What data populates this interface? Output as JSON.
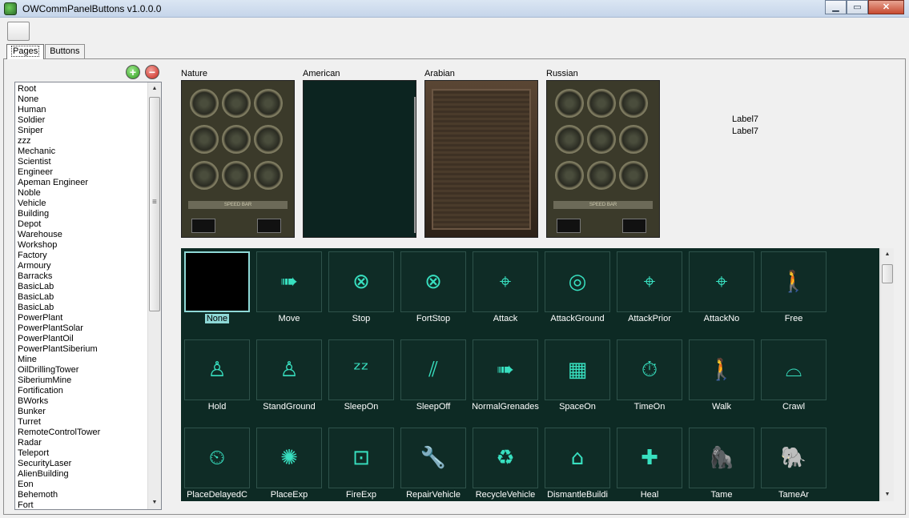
{
  "window": {
    "title": "OWCommPanelButtons v1.0.0.0",
    "minimize": "▁",
    "maximize": "▭",
    "close": "✕"
  },
  "tabs": [
    {
      "label": "Pages",
      "active": true
    },
    {
      "label": "Buttons",
      "active": false
    }
  ],
  "list_controls": {
    "add": "+",
    "remove": "−"
  },
  "pages": [
    "Root",
    "None",
    "Human",
    "Soldier",
    "Sniper",
    "zzz",
    "Mechanic",
    "Scientist",
    "Engineer",
    "Apeman Engineer",
    "Noble",
    "Vehicle",
    "Building",
    "Depot",
    "Warehouse",
    "Workshop",
    "Factory",
    "Armoury",
    "Barracks",
    "BasicLab",
    "BasicLab",
    "BasicLab",
    "PowerPlant",
    "PowerPlantSolar",
    "PowerPlantOil",
    "PowerPlantSiberium",
    "Mine",
    "OilDrillingTower",
    "SiberiumMine",
    "Fortification",
    "BWorks",
    "Bunker",
    "Turret",
    "RemoteControlTower",
    "Radar",
    "Teleport",
    "SecurityLaser",
    "AlienBuilding",
    "Eon",
    "Behemoth",
    "Fort"
  ],
  "factions": [
    {
      "name": "Nature",
      "style": "nature"
    },
    {
      "name": "American",
      "style": "american"
    },
    {
      "name": "Arabian",
      "style": "arabian"
    },
    {
      "name": "Russian",
      "style": "russian"
    }
  ],
  "speedbar_text": "SPEED BAR",
  "labels": [
    "Label7",
    "Label7"
  ],
  "buttons": [
    {
      "label": "None",
      "icon": "empty",
      "glyph": "",
      "selected": true
    },
    {
      "label": "Move",
      "icon": "move-arrows-icon",
      "glyph": "➠"
    },
    {
      "label": "Stop",
      "icon": "stop-icon",
      "glyph": "⊗"
    },
    {
      "label": "FortStop",
      "icon": "fort-stop-icon",
      "glyph": "⊗"
    },
    {
      "label": "Attack",
      "icon": "crosshair-icon",
      "glyph": "⌖"
    },
    {
      "label": "AttackGround",
      "icon": "attack-ground-icon",
      "glyph": "◎"
    },
    {
      "label": "AttackPrior",
      "icon": "attack-prior-icon",
      "glyph": "⌖"
    },
    {
      "label": "AttackNo",
      "icon": "attack-no-icon",
      "glyph": "⌖"
    },
    {
      "label": "Free",
      "icon": "free-person-icon",
      "glyph": "🚶"
    },
    {
      "label": "Hold",
      "icon": "hold-person-icon",
      "glyph": "♙"
    },
    {
      "label": "StandGround",
      "icon": "stand-ground-icon",
      "glyph": "♙"
    },
    {
      "label": "SleepOn",
      "icon": "sleep-on-icon",
      "glyph": "ᶻᶻ"
    },
    {
      "label": "SleepOff",
      "icon": "sleep-off-icon",
      "glyph": "⫽"
    },
    {
      "label": "NormalGrenades",
      "icon": "grenades-icon",
      "glyph": "➠"
    },
    {
      "label": "SpaceOn",
      "icon": "space-on-icon",
      "glyph": "▦"
    },
    {
      "label": "TimeOn",
      "icon": "time-on-icon",
      "glyph": "⏱"
    },
    {
      "label": "Walk",
      "icon": "walk-icon",
      "glyph": "🚶"
    },
    {
      "label": "Crawl",
      "icon": "crawl-icon",
      "glyph": "⌓"
    },
    {
      "label": "PlaceDelayedC",
      "icon": "delayed-charge-icon",
      "glyph": "⏲"
    },
    {
      "label": "PlaceExp",
      "icon": "place-explosive-icon",
      "glyph": "✺"
    },
    {
      "label": "FireExp",
      "icon": "fire-explosive-icon",
      "glyph": "⊡"
    },
    {
      "label": "RepairVehicle",
      "icon": "wrench-icon",
      "glyph": "🔧"
    },
    {
      "label": "RecycleVehicle",
      "icon": "recycle-icon",
      "glyph": "♻"
    },
    {
      "label": "DismantleBuildi",
      "icon": "dismantle-icon",
      "glyph": "⌂"
    },
    {
      "label": "Heal",
      "icon": "heal-cross-icon",
      "glyph": "✚"
    },
    {
      "label": "Tame",
      "icon": "tame-icon",
      "glyph": "🦍"
    },
    {
      "label": "TameAr",
      "icon": "mammoth-icon",
      "glyph": "🐘"
    }
  ]
}
